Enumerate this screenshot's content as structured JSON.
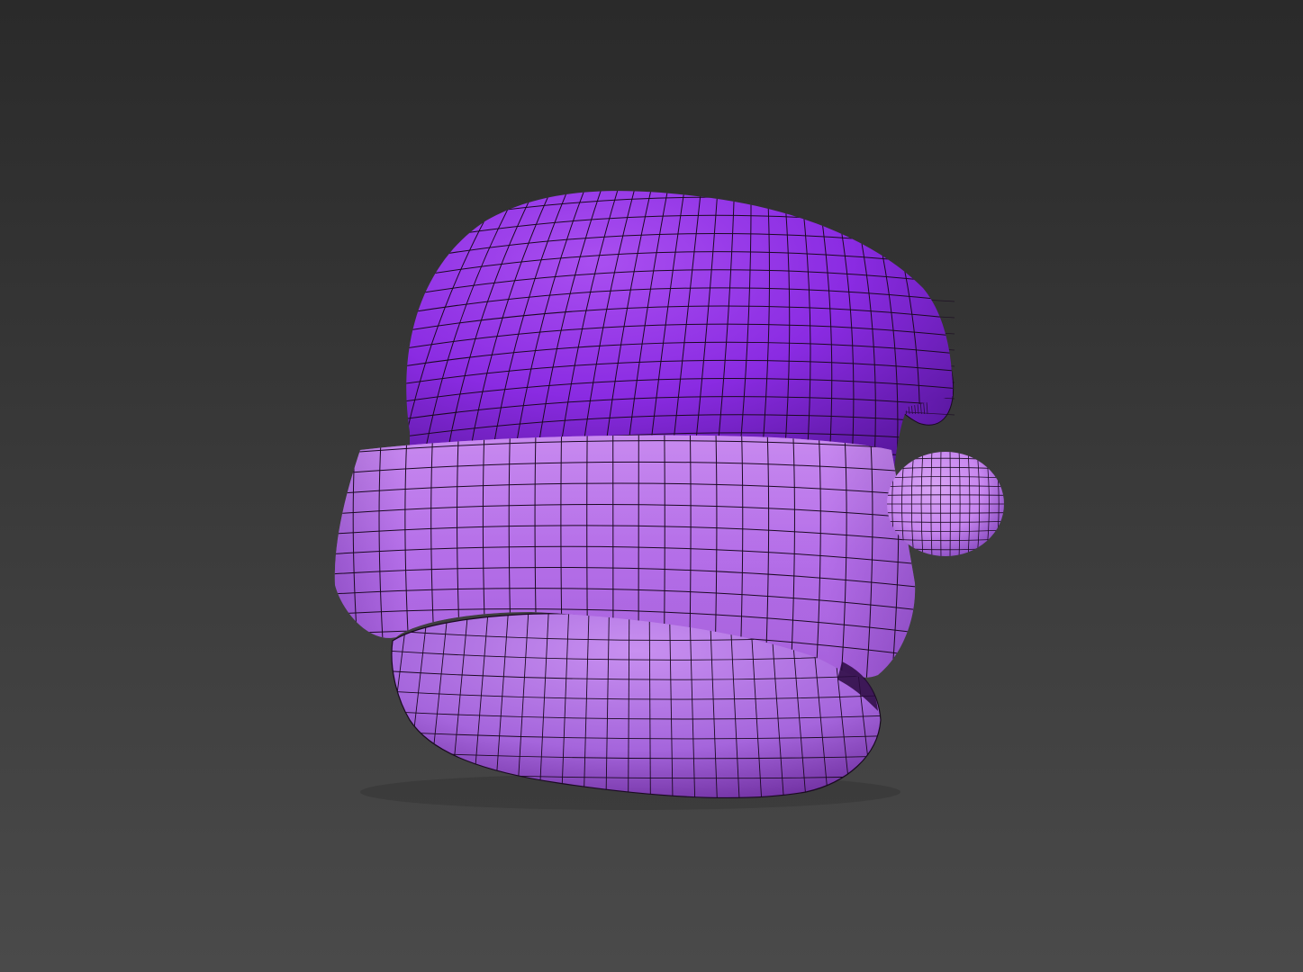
{
  "viewport": {
    "background_top": "#2a2a2a",
    "background_bottom": "#4a4a4a"
  },
  "model": {
    "subject": "santa-hat-wireframe",
    "colors": {
      "cap_light": "#a94ff0",
      "cap_base": "#8a2be2",
      "cap_dark": "#5a17a0",
      "cuff_light": "#d8a0f5",
      "cuff_base": "#b46ee8",
      "cuff_dark": "#7a3db0",
      "inner_light": "#c890f0",
      "inner_dark": "#6a2a9a",
      "pompom": "#c786ef",
      "wire": "#1a0a22"
    }
  }
}
